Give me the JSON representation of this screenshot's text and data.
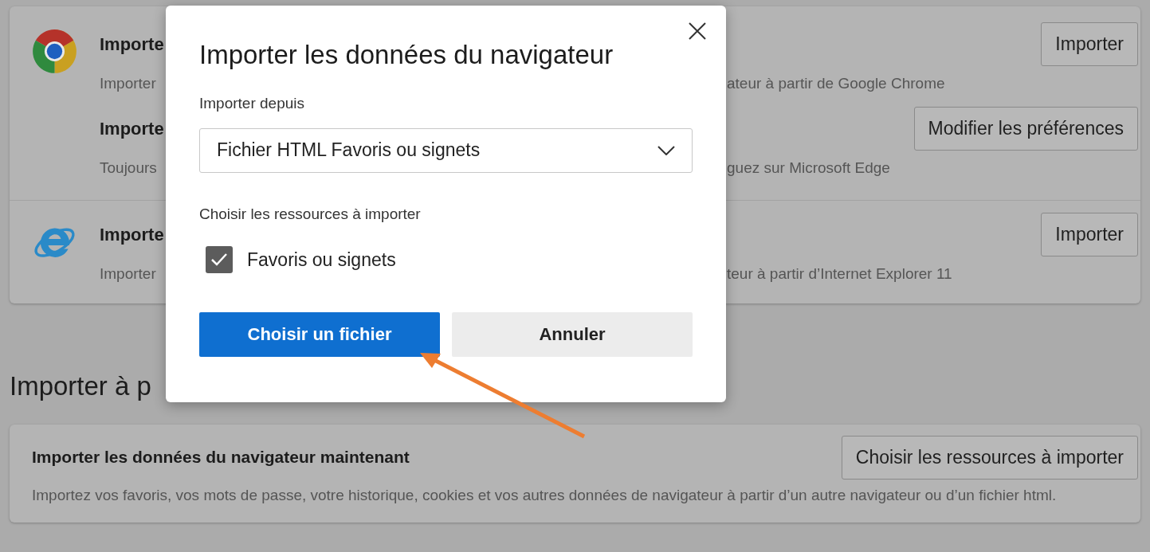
{
  "import_card": {
    "groups": [
      {
        "kind": "chrome",
        "rows": [
          {
            "title": "Importe",
            "description": "Importer",
            "description_right": "ateur à partir de Google Chrome",
            "button": "Importer"
          },
          {
            "title": "Importe",
            "description": "Toujours",
            "description_right": "guez sur Microsoft Edge",
            "button": "Modifier les préférences"
          }
        ]
      },
      {
        "kind": "ie",
        "rows": [
          {
            "title": "Importe",
            "description": "Importer",
            "description_right": "teur à partir d’Internet Explorer 11",
            "button": "Importer"
          }
        ]
      }
    ]
  },
  "section_heading": "Importer à p",
  "browser_card": {
    "title": "Importer les données du navigateur maintenant",
    "description": "Importez vos favoris, vos mots de passe, votre historique, cookies et vos autres données de navigateur à partir d’un autre navigateur ou d’un fichier html.",
    "button": "Choisir les ressources à importer"
  },
  "dialog": {
    "title": "Importer les données du navigateur",
    "source_label": "Importer depuis",
    "source_value": "Fichier HTML Favoris ou signets",
    "resources_label": "Choisir les ressources à importer",
    "resources": [
      {
        "label": "Favoris ou signets",
        "checked": true
      }
    ],
    "buttons": [
      {
        "label": "Choisir un fichier",
        "kind": "primary"
      },
      {
        "label": "Annuler",
        "kind": "secondary"
      }
    ]
  },
  "annotation": {
    "kind": "arrow"
  }
}
